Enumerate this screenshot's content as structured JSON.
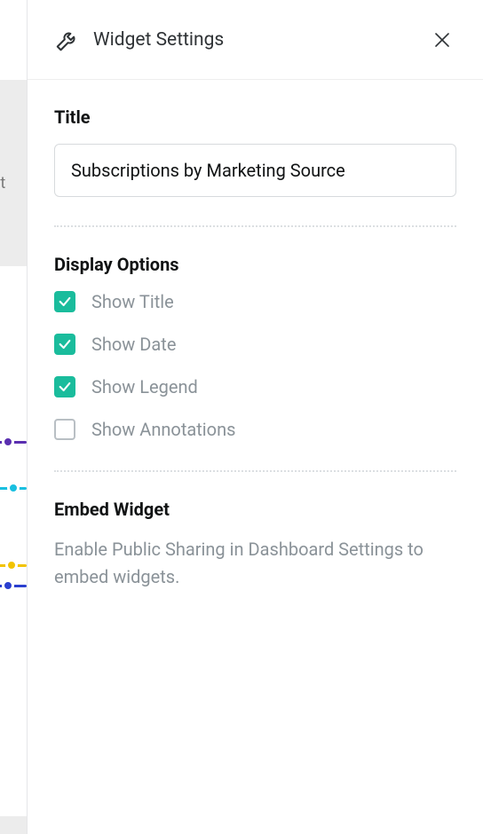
{
  "panel_title": "Widget Settings",
  "title_section": {
    "label": "Title",
    "value": "Subscriptions by Marketing Source"
  },
  "display_options": {
    "label": "Display Options",
    "items": [
      {
        "label": "Show Title",
        "checked": true
      },
      {
        "label": "Show Date",
        "checked": true
      },
      {
        "label": "Show Legend",
        "checked": true
      },
      {
        "label": "Show Annotations",
        "checked": false
      }
    ]
  },
  "embed": {
    "label": "Embed Widget",
    "description": "Enable Public Sharing in Dashboard Settings to embed widgets."
  },
  "bg_hint_text": "rint"
}
